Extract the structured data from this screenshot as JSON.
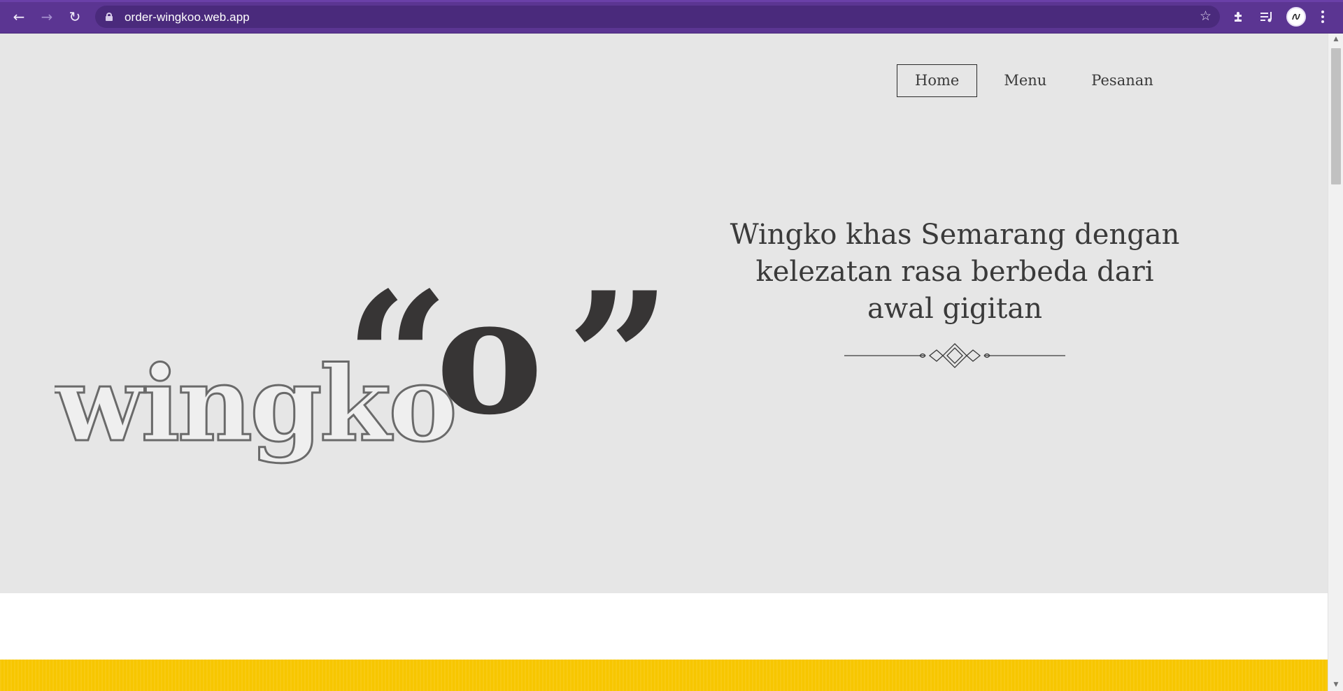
{
  "browser": {
    "url": "order-wingkoo.web.app",
    "icons": {
      "back": "back-arrow-icon",
      "forward": "forward-arrow-icon",
      "reload": "reload-icon",
      "lock": "lock-icon",
      "bookmark": "star-icon",
      "extensions": "puzzle-icon",
      "media": "playlist-icon",
      "profile": "avatar",
      "menu": "three-dots-icon"
    },
    "theme_color": "#5b3592"
  },
  "site": {
    "nav": [
      {
        "label": "Home",
        "active": true
      },
      {
        "label": "Menu",
        "active": false
      },
      {
        "label": "Pesanan",
        "active": false
      }
    ],
    "logo": {
      "word": "wingko",
      "letter": "o",
      "open_quote": "“",
      "close_quote": "”"
    },
    "tagline": "Wingko khas Semarang dengan kelezatan rasa berbeda dari awal gigitan",
    "colors": {
      "hero_bg": "#e6e6e6",
      "text": "#3a3a3a",
      "band_white": "#ffffff",
      "band_yellow": "#f7c600"
    }
  }
}
